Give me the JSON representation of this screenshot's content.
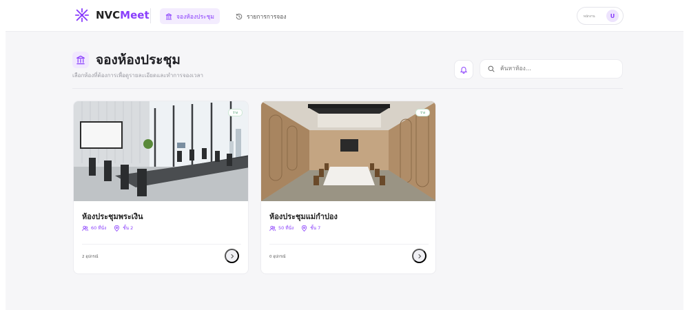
{
  "app": {
    "brand_prefix": "NVC",
    "brand_accent": "Meet",
    "accent_color": "#8a3ffc"
  },
  "nav": {
    "tabs": [
      {
        "label": "จองห้องประชุม",
        "icon": "building-columns-icon",
        "active": true
      },
      {
        "label": "รายการการจอง",
        "icon": "history-icon",
        "active": false
      }
    ]
  },
  "profile": {
    "name": "พนักงาน",
    "initial": "U"
  },
  "page": {
    "title": "จองห้องประชุม",
    "subtitle": "เลือกห้องที่ต้องการเพื่อดูรายละเอียดและทำการจองเวลา"
  },
  "search": {
    "placeholder": "ค้นหาห้อง..."
  },
  "rooms": [
    {
      "name": "ห้องประชุมพระเงิน",
      "capacity": "60 ที่นั่ง",
      "floor": "ชั้น 2",
      "status": "ว่าง",
      "equipment": "2 อุปกรณ์"
    },
    {
      "name": "ห้องประชุมแม่กำปอง",
      "capacity": "50 ที่นั่ง",
      "floor": "ชั้น 7",
      "status": "ว่าง",
      "equipment": "0 อุปกรณ์"
    }
  ]
}
